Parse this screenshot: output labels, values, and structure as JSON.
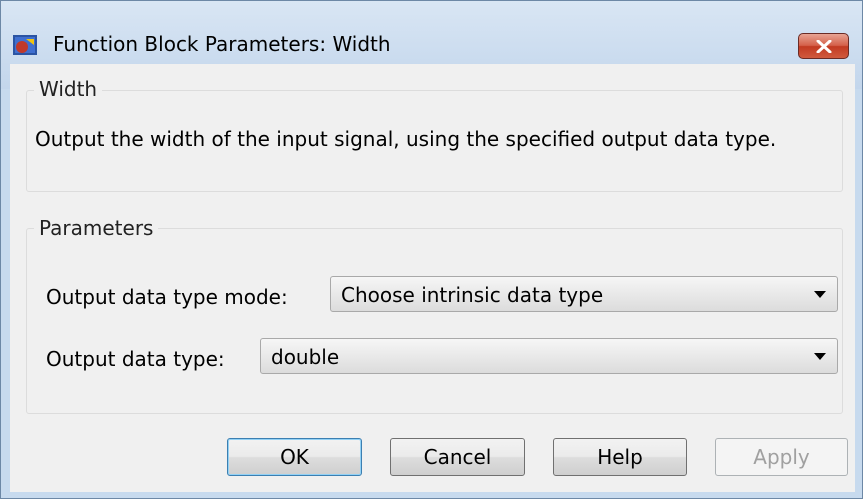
{
  "window": {
    "title": "Function Block Parameters: Width"
  },
  "description_group": {
    "legend": "Width",
    "text": "Output the width of the input signal, using the specified output data type."
  },
  "parameters_group": {
    "legend": "Parameters",
    "output_data_type_mode": {
      "label": "Output data type mode:",
      "value": "Choose intrinsic data type"
    },
    "output_data_type": {
      "label": "Output data type:",
      "value": "double"
    }
  },
  "buttons": {
    "ok": "OK",
    "cancel": "Cancel",
    "help": "Help",
    "apply": "Apply"
  },
  "colors": {
    "title_bar": "#c7daee",
    "close_button": "#c23a22",
    "dialog_body": "#f0f0f0"
  },
  "icons": {
    "app": "simulink-block-icon",
    "close": "close-icon",
    "dropdown": "chevron-down-icon"
  }
}
